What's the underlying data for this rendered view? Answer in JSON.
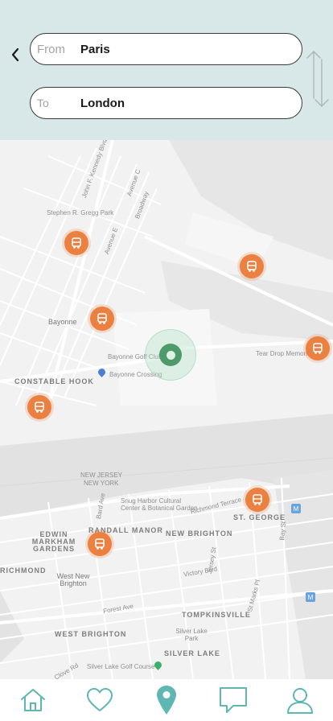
{
  "header": {
    "from_label": "From",
    "from_value": "Paris",
    "to_label": "To",
    "to_value": "London"
  },
  "map": {
    "places": {
      "stephen_park": "Stephen R. Gregg Park",
      "bayonne": "Bayonne",
      "constable_hook": "CONSTABLE HOOK",
      "bayonne_golf": "Bayonne Golf Club",
      "bayonne_crossing": "Bayonne Crossing",
      "tear_drop": "Tear Drop Memorial",
      "new_jersey": "NEW JERSEY",
      "new_york": "NEW YORK",
      "snug_harbor": "Snug Harbor Cultural Center & Botanical Garden",
      "randall_manor": "RANDALL MANOR",
      "new_brighton": "NEW BRIGHTON",
      "st_george": "ST. GEORGE",
      "edwin_markham": "EDWIN MARKHAM GARDENS",
      "richmond": "RICHMOND",
      "west_new_brighton": "West New Brighton",
      "tompkinsville": "TOMPKINSVILLE",
      "west_brighton": "WEST BRIGHTON",
      "silver_lake_park": "Silver Lake Park",
      "silver_lake": "SILVER LAKE",
      "silver_lake_golf": "Silver Lake Golf Course"
    },
    "streets": [
      "John F. Kennedy Blvd",
      "Avenue C",
      "Broadway",
      "Avenue E",
      "Richmond Terrace",
      "Forest Ave",
      "Bard Ave",
      "Victory Blvd",
      "St Marks Pl",
      "Bay St",
      "Jersey St",
      "Clove Rd"
    ]
  },
  "icons": {
    "back": "chevron-left-icon",
    "swap": "swap-vertical-icon",
    "bus": "bus-icon",
    "home": "home-icon",
    "favorites": "heart-icon",
    "map": "location-pin-icon",
    "messages": "chat-bubble-icon",
    "profile": "user-icon"
  },
  "colors": {
    "header_bg": "#d8e7e7",
    "accent": "#5fb7b4",
    "bus_marker": "#ec8040",
    "user_location": "#4f9a6b"
  },
  "nav": {
    "active": "map"
  }
}
